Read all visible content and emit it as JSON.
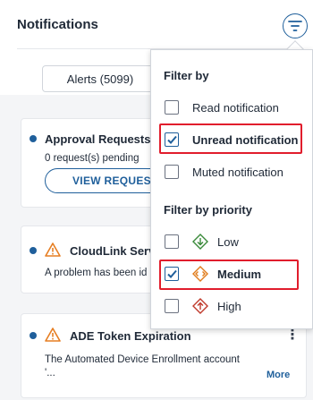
{
  "header": {
    "title": "Notifications",
    "filter_icon": "filter-icon"
  },
  "tabs": [
    {
      "label": "Alerts (5099)"
    }
  ],
  "cards": [
    {
      "title": "Approval Requests",
      "text": "0 request(s) pending",
      "button": "VIEW REQUEST"
    },
    {
      "title": "CloudLink Serv",
      "text": "A problem has been id"
    },
    {
      "title": "ADE Token Expiration",
      "text": "The Automated Device Enrollment account",
      "text2": "'...",
      "more": "More"
    }
  ],
  "filter": {
    "section1": "Filter by",
    "options": [
      {
        "label": "Read notification",
        "checked": false
      },
      {
        "label": "Unread notification",
        "checked": true
      },
      {
        "label": "Muted notification",
        "checked": false
      }
    ],
    "section2": "Filter by priority",
    "priorities": [
      {
        "label": "Low",
        "checked": false,
        "icon": "low-priority-icon",
        "color": "#3a8a3a"
      },
      {
        "label": "Medium",
        "checked": true,
        "icon": "medium-priority-icon",
        "color": "#e07b1a"
      },
      {
        "label": "High",
        "checked": false,
        "icon": "high-priority-icon",
        "color": "#c0392b"
      }
    ]
  },
  "colors": {
    "accent": "#1f5f9b",
    "highlight": "#e11d2c",
    "warning": "#e67e22"
  }
}
